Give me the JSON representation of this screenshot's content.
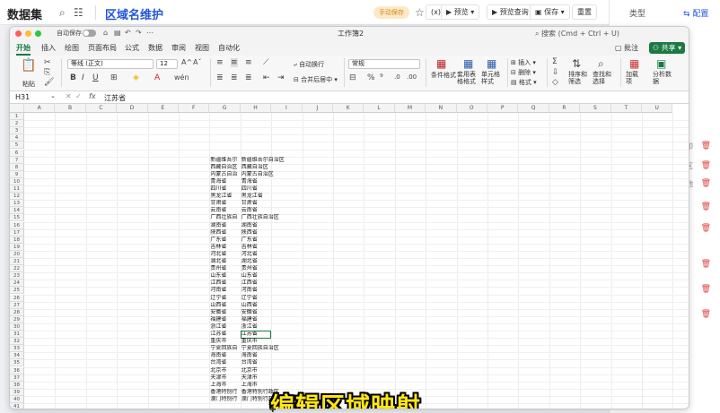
{
  "app": {
    "dataset_title": "数据集",
    "page_title": "区域名维护",
    "chip": "手动保存",
    "buttons": [
      "预览",
      "预览查询",
      "保存",
      "重置"
    ],
    "right_panel": {
      "type_label": "类型",
      "config_label": "配置",
      "items": [
        "字段",
        "打印",
        "区",
        "池"
      ]
    }
  },
  "excel": {
    "autosave_label": "自动保存",
    "workbook_name": "工作簿2",
    "search_placeholder": "搜索 (Cmd + Ctrl + U)",
    "tabs": [
      "开始",
      "插入",
      "绘图",
      "页面布局",
      "公式",
      "数据",
      "审阅",
      "视图",
      "自动化"
    ],
    "comment_label": "批注",
    "share_label": "共享",
    "ribbon": {
      "paste": "粘贴",
      "font_name": "等线 (正文)",
      "font_size": "12",
      "wrap_text": "自动换行",
      "merge_center": "合并后居中",
      "number_format": "常规",
      "cond_format": "条件格式",
      "table_format": "套用表格格式",
      "cell_style": "单元格样式",
      "insert": "插入",
      "delete": "删除",
      "format": "格式",
      "sort_filter": "排序和筛选",
      "find_select": "查找和选择",
      "addins": "加载项",
      "analyze": "分析数据"
    },
    "name_box": "H31",
    "formula_value": "江苏省",
    "columns": [
      "A",
      "B",
      "C",
      "D",
      "E",
      "F",
      "G",
      "H",
      "I",
      "J",
      "K",
      "L",
      "M",
      "N",
      "O",
      "P",
      "Q",
      "R",
      "S",
      "T",
      "U"
    ],
    "rows": [
      {
        "n": "1",
        "g": "",
        "h": ""
      },
      {
        "n": "2",
        "g": "",
        "h": ""
      },
      {
        "n": "3",
        "g": "",
        "h": ""
      },
      {
        "n": "4",
        "g": "",
        "h": ""
      },
      {
        "n": "5",
        "g": "",
        "h": ""
      },
      {
        "n": "6",
        "g": "",
        "h": ""
      },
      {
        "n": "7",
        "g": "新疆维吾尔",
        "h": "新疆维吾尔自治区"
      },
      {
        "n": "8",
        "g": "西藏自治区",
        "h": "西藏自治区"
      },
      {
        "n": "9",
        "g": "内蒙古自治",
        "h": "内蒙古自治区"
      },
      {
        "n": "10",
        "g": "青海省",
        "h": "青海省"
      },
      {
        "n": "11",
        "g": "四川省",
        "h": "四川省"
      },
      {
        "n": "12",
        "g": "黑龙江省",
        "h": "黑龙江省"
      },
      {
        "n": "13",
        "g": "甘肃省",
        "h": "甘肃省"
      },
      {
        "n": "14",
        "g": "云南省",
        "h": "云南省"
      },
      {
        "n": "15",
        "g": "广西壮族自",
        "h": "广西壮族自治区"
      },
      {
        "n": "16",
        "g": "湖南省",
        "h": "湖南省"
      },
      {
        "n": "17",
        "g": "陕西省",
        "h": "陕西省"
      },
      {
        "n": "18",
        "g": "广东省",
        "h": "广东省"
      },
      {
        "n": "19",
        "g": "吉林省",
        "h": "吉林省"
      },
      {
        "n": "20",
        "g": "河北省",
        "h": "河北省"
      },
      {
        "n": "21",
        "g": "湖北省",
        "h": "湖北省"
      },
      {
        "n": "22",
        "g": "贵州省",
        "h": "贵州省"
      },
      {
        "n": "23",
        "g": "山东省",
        "h": "山东省"
      },
      {
        "n": "24",
        "g": "江西省",
        "h": "江西省"
      },
      {
        "n": "25",
        "g": "河南省",
        "h": "河南省"
      },
      {
        "n": "26",
        "g": "辽宁省",
        "h": "辽宁省"
      },
      {
        "n": "27",
        "g": "山西省",
        "h": "山西省"
      },
      {
        "n": "28",
        "g": "安徽省",
        "h": "安徽省"
      },
      {
        "n": "29",
        "g": "福建省",
        "h": "福建省"
      },
      {
        "n": "30",
        "g": "浙江省",
        "h": "浙江省"
      },
      {
        "n": "31",
        "g": "江苏省",
        "h": "江苏省"
      },
      {
        "n": "32",
        "g": "重庆市",
        "h": "重庆市"
      },
      {
        "n": "33",
        "g": "宁夏回族自",
        "h": "宁夏回族自治区"
      },
      {
        "n": "34",
        "g": "海南省",
        "h": "海南省"
      },
      {
        "n": "35",
        "g": "台湾省",
        "h": "台湾省"
      },
      {
        "n": "36",
        "g": "北京市",
        "h": "北京市"
      },
      {
        "n": "37",
        "g": "天津市",
        "h": "天津市"
      },
      {
        "n": "38",
        "g": "上海市",
        "h": "上海市"
      },
      {
        "n": "39",
        "g": "香港特别行",
        "h": "香港特别行政区"
      },
      {
        "n": "40",
        "g": "澳门特别行",
        "h": "澳门特别行政区"
      },
      {
        "n": "41",
        "g": "",
        "h": ""
      }
    ]
  },
  "caption": "编辑区域映射"
}
